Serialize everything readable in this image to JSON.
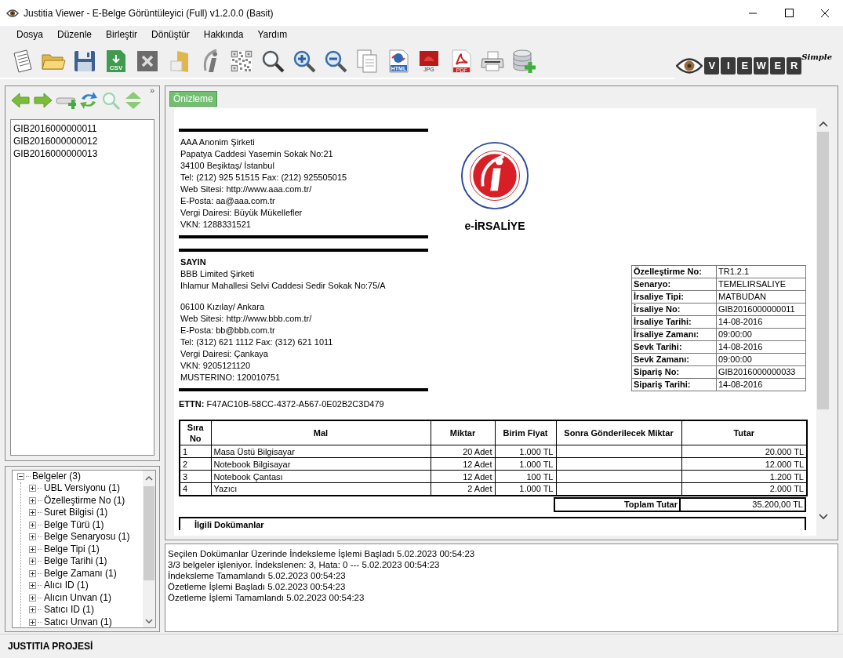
{
  "window": {
    "title": "Justitia Viewer -  E-Belge Görüntüleyici (Full) v1.2.0.0 (Basit)"
  },
  "menu": [
    "Dosya",
    "Düzenle",
    "Birleştir",
    "Dönüştür",
    "Hakkında",
    "Yardım"
  ],
  "toolbar": [
    {
      "kind": "document"
    },
    {
      "kind": "folder"
    },
    {
      "kind": "save"
    },
    {
      "kind": "csv",
      "label": "CSV"
    },
    {
      "kind": "close"
    },
    {
      "kind": "folder-box"
    },
    {
      "kind": "slanted-i"
    },
    {
      "kind": "qr"
    },
    {
      "kind": "search"
    },
    {
      "kind": "zoom-in"
    },
    {
      "kind": "zoom-out"
    },
    {
      "kind": "copy"
    },
    {
      "kind": "html",
      "label": "HTML"
    },
    {
      "kind": "jpg",
      "label": "JPG"
    },
    {
      "kind": "pdf",
      "label": "PDF"
    },
    {
      "kind": "print"
    },
    {
      "kind": "database-add"
    }
  ],
  "logo": {
    "letters": [
      "V",
      "I",
      "E",
      "W",
      "E",
      "R"
    ],
    "tag": "Simple"
  },
  "nav_toolbar": {
    "items": [
      {
        "kind": "back"
      },
      {
        "kind": "forward"
      },
      {
        "kind": "tray-add"
      },
      {
        "kind": "refresh"
      },
      {
        "kind": "search"
      },
      {
        "kind": "up-down"
      }
    ],
    "overflow": "»"
  },
  "documents": [
    {
      "label": "GIB2016000000011",
      "selected": false
    },
    {
      "label": "GIB2016000000012",
      "selected": false
    },
    {
      "label": "GIB2016000000013",
      "selected": false
    }
  ],
  "tree": {
    "label": "Belgeler (3)",
    "expanded": true,
    "children": [
      {
        "label": "UBL Versiyonu (1)",
        "expanded": false
      },
      {
        "label": "Özelleştirme No (1)",
        "expanded": false
      },
      {
        "label": "Suret Bilgisi (1)",
        "expanded": false
      },
      {
        "label": "Belge Türü (1)",
        "expanded": false
      },
      {
        "label": "Belge Senaryosu (1)",
        "expanded": false
      },
      {
        "label": "Belge Tipi (1)",
        "expanded": false
      },
      {
        "label": "Belge Tarihi (1)",
        "expanded": false
      },
      {
        "label": "Belge Zamanı (1)",
        "expanded": false
      },
      {
        "label": "Alıcı ID (1)",
        "expanded": false
      },
      {
        "label": "Alıcın Unvan (1)",
        "expanded": false
      },
      {
        "label": "Satıcı ID (1)",
        "expanded": false
      },
      {
        "label": "Satıcı Unvan (1)",
        "expanded": false
      }
    ]
  },
  "tabs": [
    {
      "label": "Önizleme",
      "selected": true
    }
  ],
  "document": {
    "sender": [
      "AAA Anonim Şirketi",
      "Papatya Caddesi Yasemin Sokak  No:21",
      "34100 Beşiktaş/ İstanbul",
      "Tel: (212) 925 51515 Fax: (212) 925505015",
      "Web Sitesi: http://www.aaa.com.tr/",
      "E-Posta: aa@aaa.com.tr",
      "Vergi Dairesi: Büyük Mükellefler",
      "VKN: 1288331521"
    ],
    "title": "e-İRSALİYE",
    "recipient_heading": "SAYIN",
    "recipient": [
      [
        "BBB Limited Şirketi",
        "Ihlamur Mahallesi Selvi Caddesi Sedir Sokak  No:75/A"
      ],
      [
        "06100 Kızılay/ Ankara",
        "Web Sitesi: http://www.bbb.com.tr/",
        "E-Posta: bb@bbb.com.tr",
        "Tel: (312) 621 1112 Fax: (312) 621 1011",
        "Vergi Dairesi: Çankaya",
        "VKN: 9205121120",
        "MUSTERINO: 120010751"
      ]
    ],
    "meta": [
      {
        "label": "Özelleştirme No:",
        "value": "TR1.2.1"
      },
      {
        "label": "Senaryo:",
        "value": "TEMELIRSALIYE"
      },
      {
        "label": "İrsaliye Tipi:",
        "value": "MATBUDAN"
      },
      {
        "label": "İrsaliye No:",
        "value": "GIB2016000000011"
      },
      {
        "label": "İrsaliye Tarihi:",
        "value": "14-08-2016"
      },
      {
        "label": "İrsaliye Zamanı:",
        "value": "09:00:00"
      },
      {
        "label": "Sevk Tarihi:",
        "value": "14-08-2016"
      },
      {
        "label": "Sevk Zamanı:",
        "value": "09:00:00"
      },
      {
        "label": "Sipariş No:",
        "value": "GIB2016000000033"
      },
      {
        "label": "Sipariş Tarihi:",
        "value": "14-08-2016"
      }
    ],
    "ettn": {
      "label": "ETTN:",
      "value": "F47AC10B-58CC-4372-A567-0E02B2C3D479"
    },
    "items": {
      "columns": [
        "Sıra No",
        "Mal",
        "Miktar",
        "Birim Fiyat",
        "Sonra Gönderilecek Miktar",
        "Tutar"
      ],
      "rows": [
        [
          "1",
          "Masa Üstü Bilgisayar",
          "20 Adet",
          "1.000 TL",
          "",
          "20.000 TL"
        ],
        [
          "2",
          "Notebook Bilgisayar",
          "12 Adet",
          "1.000 TL",
          "",
          "12.000 TL"
        ],
        [
          "3",
          "Notebook Çantası",
          "12 Adet",
          "100 TL",
          "",
          "1.200 TL"
        ],
        [
          "4",
          "Yazıcı",
          "2 Adet",
          "1.000 TL",
          "",
          "2.000 TL"
        ]
      ]
    },
    "total": {
      "label": "Toplam Tutar",
      "value": "35.200,00 TL"
    },
    "related_heading": "İlgili Dokümanlar"
  },
  "log": [
    "Seçilen Dokümanlar Üzerinde İndeksleme İşlemi Başladı 5.02.2023 00:54:23",
    "3/3 belgeler işleniyor. İndekslenen: 3, Hata: 0 --- 5.02.2023 00:54:23",
    "İndeksleme Tamamlandı 5.02.2023 00:54:23",
    "Özetleme İşlemi Başladı 5.02.2023 00:54:23",
    "Özetleme İşlemi Tamamlandı 5.02.2023 00:54:23"
  ],
  "status_bar": "JUSTITIA PROJESİ"
}
